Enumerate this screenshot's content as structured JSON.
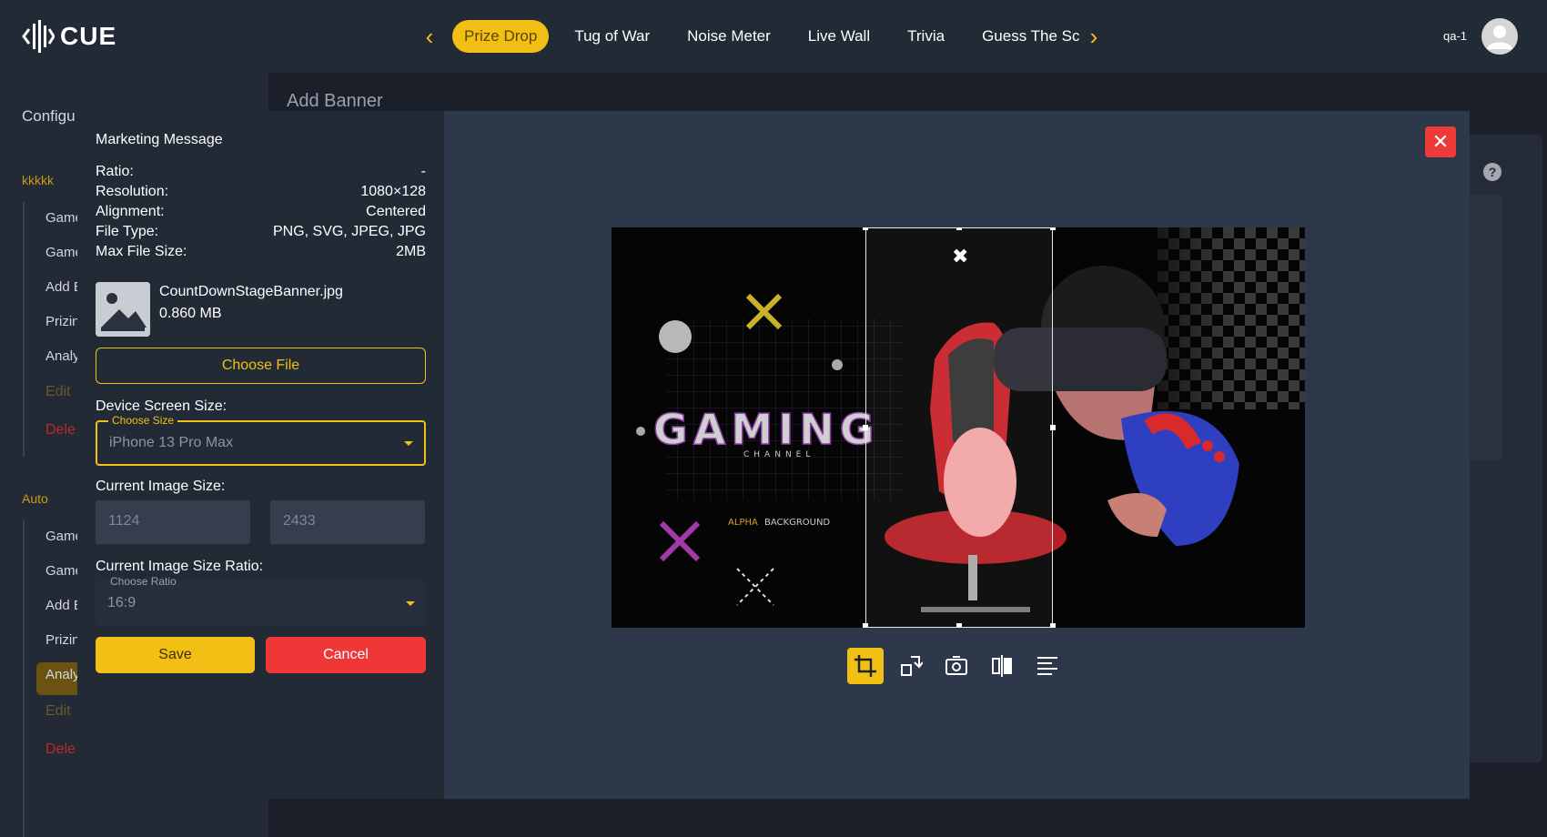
{
  "app": {
    "name": "CUE",
    "user": "qa-1"
  },
  "nav": {
    "tabs": [
      {
        "label": "Prize Drop",
        "active": true
      },
      {
        "label": "Tug of War"
      },
      {
        "label": "Noise Meter"
      },
      {
        "label": "Live Wall"
      },
      {
        "label": "Trivia"
      },
      {
        "label": "Guess The Sc"
      }
    ]
  },
  "sidebar": {
    "config_label": "Configu",
    "section1": "kkkkk",
    "section1_items": [
      "Game",
      "Game",
      "Add E",
      "Prizin",
      "Analy",
      "Edit",
      "Dele"
    ],
    "section2": "Auto",
    "section2_items": [
      "Game",
      "Game",
      "Add E",
      "Prizin",
      "Analy",
      "Edit",
      "Dele"
    ]
  },
  "page": {
    "title": "Add Banner"
  },
  "modal": {
    "title": "Marketing Message",
    "specs": [
      {
        "key": "Ratio:",
        "value": "-"
      },
      {
        "key": "Resolution:",
        "value": "1080×128"
      },
      {
        "key": "Alignment:",
        "value": "Centered"
      },
      {
        "key": "File Type:",
        "value": "PNG, SVG, JPEG, JPG"
      },
      {
        "key": "Max File Size:",
        "value": "2MB"
      }
    ],
    "file": {
      "name": "CountDownStageBanner.jpg",
      "size": "0.860 MB"
    },
    "choose_file_label": "Choose File",
    "device_label": "Device Screen Size:",
    "device_legend": "Choose Size",
    "device_value": "iPhone 13 Pro Max",
    "image_size_label": "Current Image Size:",
    "image_width": "1124",
    "image_height": "2433",
    "ratio_label": "Current Image Size Ratio:",
    "ratio_legend": "Choose Ratio",
    "ratio_value": "16:9",
    "save_label": "Save",
    "cancel_label": "Cancel"
  },
  "image": {
    "headline": "GAMING",
    "sub": "CHANNEL",
    "tag1": "ALPHA",
    "tag2": "BACKGROUND"
  },
  "colors": {
    "accent": "#f2c014",
    "danger": "#f03737",
    "bg": "#1a1f2a"
  },
  "toolbar_icons": [
    "crop-icon",
    "rotate-icon",
    "camera-flip-icon",
    "mirror-icon",
    "align-icon"
  ]
}
